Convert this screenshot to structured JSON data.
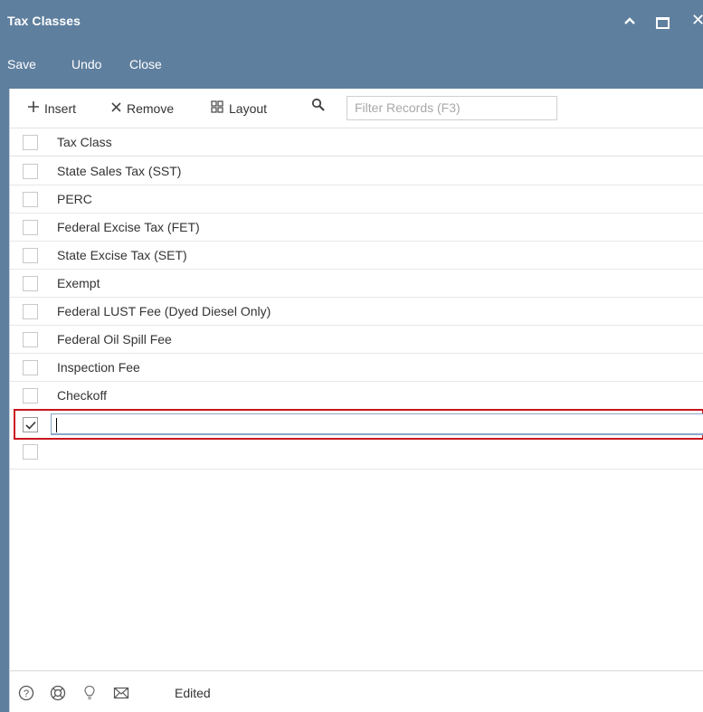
{
  "window": {
    "title": "Tax Classes",
    "controls": [
      "minimize-icon",
      "maximize-icon",
      "close-icon"
    ]
  },
  "menu": {
    "save": "Save",
    "undo": "Undo",
    "close": "Close"
  },
  "toolbar": {
    "insert": "Insert",
    "remove": "Remove",
    "layout": "Layout",
    "filter_placeholder": "Filter Records (F3)"
  },
  "grid": {
    "column_header": "Tax Class",
    "rows": [
      "State Sales Tax (SST)",
      "PERC",
      "Federal Excise Tax (FET)",
      "State Excise Tax (SET)",
      "Exempt",
      "Federal LUST Fee (Dyed Diesel Only)",
      "Federal Oil Spill Fee",
      "Inspection Fee",
      "Checkoff"
    ],
    "editing_row_value": "",
    "editing_row_checked": true
  },
  "footer": {
    "icons": [
      "help-icon",
      "support-icon",
      "lightbulb-icon",
      "mail-icon"
    ],
    "status": "Edited"
  },
  "colors": {
    "titlebar": "#5f7f9e",
    "edit_highlight": "#c9151e",
    "input_border": "#8aa6c7"
  }
}
